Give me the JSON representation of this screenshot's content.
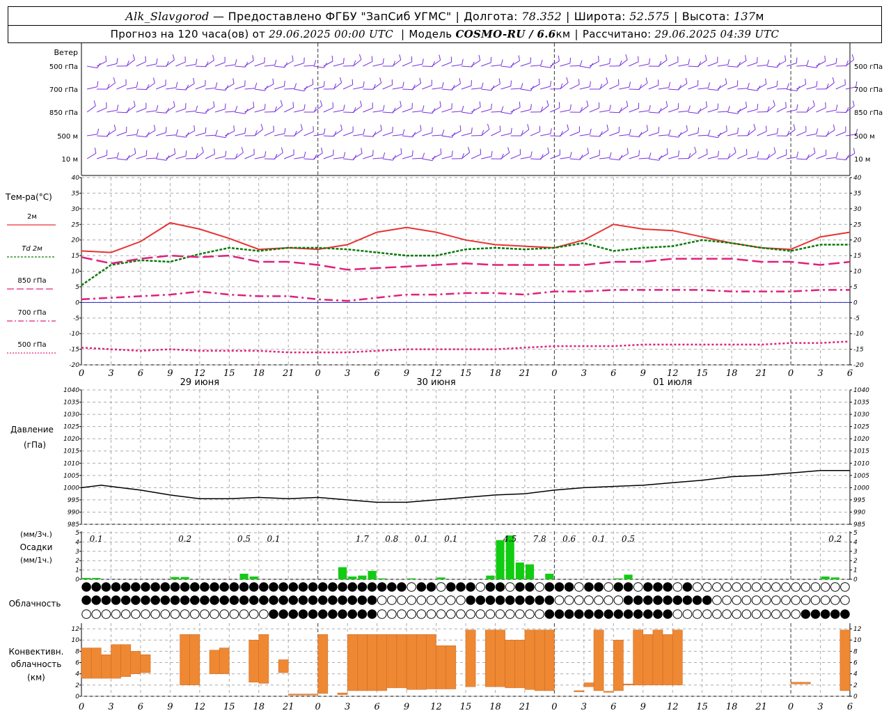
{
  "header": {
    "station": "Alk_Slavgorod",
    "provider": "— Предоставлено ФГБУ \"ЗапСиб УГМС\"",
    "lon_label": "Долгота:",
    "lon_value": "78.352",
    "lat_label": "Широта:",
    "lat_value": "52.575",
    "alt_label": "Высота:",
    "alt_value": "137",
    "alt_unit": "м",
    "forecast_prefix": "Прогноз на 120 часа(ов) от",
    "forecast_from": "29.06.2025 00:00 UTC",
    "model_label": "Модель",
    "model_value": "COSMO-RU / 6.6",
    "model_unit": "км",
    "computed_label": "Рассчитано:",
    "computed_value": "29.06.2025 04:39 UTC"
  },
  "panels": {
    "wind": {
      "title": "Ветер",
      "levels": [
        "500 гПа",
        "700 гПа",
        "850 гПа",
        "500 м",
        "10  м"
      ]
    },
    "temp": {
      "title": "Тем-ра(°C)",
      "legend": [
        {
          "label": "2м",
          "color": "#e83232",
          "style": "solid"
        },
        {
          "label": "Td  2м",
          "color": "#0a7a0a",
          "style": "dashed-short"
        },
        {
          "label": "850 гПа",
          "color": "#e0207c",
          "style": "dashed-long"
        },
        {
          "label": "700 гПа",
          "color": "#e0207c",
          "style": "dashdot"
        },
        {
          "label": "500 гПа",
          "color": "#e0207c",
          "style": "dotted"
        }
      ]
    },
    "pressure": {
      "title1": "Давление",
      "title2": "(гПа)"
    },
    "precip": {
      "title1": "(мм/3ч.)",
      "title2": "Осадки",
      "title3": "(мм/1ч.)"
    },
    "cloud": {
      "title": "Облачность"
    },
    "conv": {
      "title1": "Конвективн.",
      "title2": "облачность",
      "title3": "(км)"
    }
  },
  "dates": [
    "29 июня",
    "30 июня",
    "01 июля"
  ],
  "hour_ticks": [
    "0",
    "3",
    "6",
    "9",
    "12",
    "15",
    "18",
    "21",
    "0",
    "3",
    "6",
    "9",
    "12",
    "15",
    "18",
    "21",
    "0",
    "3",
    "6",
    "9",
    "12",
    "15",
    "18",
    "21",
    "0",
    "3",
    "6"
  ],
  "colors": {
    "temp2m": "#e83232",
    "td2m": "#0a7a0a",
    "upper": "#e0207c",
    "precip": "#11cc11",
    "conv": "#ee8833",
    "wind": "#7a2ee0",
    "pressure": "#000000"
  },
  "chart_data": [
    {
      "type": "line",
      "title": "Тем-ра(°C)",
      "x_hours": [
        0,
        3,
        6,
        9,
        12,
        15,
        18,
        21,
        24,
        27,
        30,
        33,
        36,
        39,
        42,
        45,
        48,
        51,
        54,
        57,
        60,
        63,
        66,
        69,
        72,
        75,
        78
      ],
      "ylim": [
        -20,
        40
      ],
      "yticks": [
        -20,
        -15,
        -10,
        -5,
        0,
        5,
        10,
        15,
        20,
        25,
        30,
        35,
        40
      ],
      "series": [
        {
          "name": "2м",
          "values": [
            16.5,
            16,
            19.5,
            25.5,
            23.5,
            20.5,
            17,
            17.5,
            17,
            18.5,
            22.5,
            24,
            22.5,
            20,
            18.5,
            18,
            17.5,
            20,
            25,
            23.5,
            23,
            21,
            19,
            17.5,
            17,
            21,
            22.5
          ]
        },
        {
          "name": "Td  2м",
          "values": [
            5.5,
            12,
            13.5,
            13,
            15.5,
            17.5,
            16.5,
            17.5,
            17.5,
            17,
            16,
            15,
            15,
            17,
            17.5,
            17,
            17.5,
            19,
            16.5,
            17.5,
            18,
            20,
            19,
            17.5,
            16.5,
            18.5,
            18.5
          ]
        },
        {
          "name": "850 гПа",
          "values": [
            14.5,
            12.5,
            14,
            15,
            14.5,
            15,
            13,
            13,
            12,
            10.5,
            11,
            11.5,
            12,
            12.5,
            12,
            12,
            12,
            12,
            13,
            13,
            14,
            14,
            14,
            13,
            13,
            12,
            13
          ]
        },
        {
          "name": "700 гПа",
          "values": [
            1,
            1.5,
            2,
            2.5,
            3.5,
            2.5,
            2,
            2,
            1,
            0.5,
            1.5,
            2.5,
            2.5,
            3,
            3,
            2.5,
            3.5,
            3.5,
            4,
            4,
            4,
            4,
            3.5,
            3.5,
            3.5,
            4,
            4
          ]
        },
        {
          "name": "500 гПа",
          "values": [
            -14.5,
            -15,
            -15.5,
            -15,
            -15.5,
            -15.5,
            -15.5,
            -16,
            -16,
            -16,
            -15.5,
            -15,
            -15,
            -15,
            -15,
            -14.5,
            -14,
            -14,
            -14,
            -13.5,
            -13.5,
            -13.5,
            -13.5,
            -13.5,
            -13,
            -13,
            -12.5
          ]
        }
      ]
    },
    {
      "type": "line",
      "title": "Давление",
      "ylabel": "(гПа)",
      "x_hours": [
        0,
        2,
        4,
        6,
        9,
        12,
        15,
        18,
        21,
        24,
        27,
        30,
        33,
        36,
        39,
        42,
        45,
        48,
        51,
        54,
        57,
        60,
        63,
        66,
        69,
        72,
        75,
        78
      ],
      "ylim": [
        985,
        1040
      ],
      "yticks": [
        985,
        990,
        995,
        1000,
        1005,
        1010,
        1015,
        1020,
        1025,
        1030,
        1035,
        1040
      ],
      "series": [
        {
          "name": "Давление",
          "values": [
            1000,
            1001,
            1000,
            999,
            997,
            995.5,
            995.5,
            996,
            995.5,
            996,
            995,
            994,
            994,
            995,
            996,
            997,
            997.5,
            999,
            1000,
            1000.5,
            1001,
            1002,
            1003,
            1004.5,
            1005,
            1006,
            1007,
            1007
          ]
        }
      ]
    },
    {
      "type": "bar",
      "title": "Осадки",
      "ylabel": "(мм/1ч.)",
      "ylim": [
        0,
        5
      ],
      "yticks": [
        0,
        1,
        2,
        3,
        4,
        5
      ],
      "x_hours": [
        1,
        2,
        10,
        11,
        17,
        18,
        27,
        28,
        29,
        30,
        31,
        34,
        37,
        42,
        43,
        44,
        45,
        46,
        48,
        55,
        56,
        76,
        77
      ],
      "values": [
        0.15,
        0.15,
        0.25,
        0.25,
        0.6,
        0.3,
        1.3,
        0.3,
        0.4,
        0.9,
        0.1,
        0.1,
        0.2,
        0.4,
        4.2,
        4.7,
        1.8,
        1.6,
        0.6,
        0.1,
        0.5,
        0.3,
        0.2
      ],
      "labels_3h": [
        {
          "x_hour": 1.5,
          "text": "0.1"
        },
        {
          "x_hour": 10.5,
          "text": "0.2"
        },
        {
          "x_hour": 16.5,
          "text": "0.5"
        },
        {
          "x_hour": 19.5,
          "text": "0.1"
        },
        {
          "x_hour": 28.5,
          "text": "1.7"
        },
        {
          "x_hour": 31.5,
          "text": "0.8"
        },
        {
          "x_hour": 34.5,
          "text": "0.1"
        },
        {
          "x_hour": 37.5,
          "text": "0.1"
        },
        {
          "x_hour": 43.5,
          "text": "4.5"
        },
        {
          "x_hour": 46.5,
          "text": "7.8"
        },
        {
          "x_hour": 49.5,
          "text": "0.6"
        },
        {
          "x_hour": 52.5,
          "text": "0.1"
        },
        {
          "x_hour": 55.5,
          "text": "0.5"
        },
        {
          "x_hour": 76.5,
          "text": "0.2"
        }
      ]
    },
    {
      "type": "bar",
      "title": "Конвективн. облачность",
      "ylabel": "(км)",
      "ylim": [
        0,
        13
      ],
      "yticks": [
        0,
        2,
        4,
        6,
        8,
        10,
        12
      ],
      "bars": [
        {
          "x_hour": 0.5,
          "bottom": 3.2,
          "top": 8.6
        },
        {
          "x_hour": 1.5,
          "bottom": 3.2,
          "top": 8.6
        },
        {
          "x_hour": 2.5,
          "bottom": 3.2,
          "top": 7.4
        },
        {
          "x_hour": 3.5,
          "bottom": 3.2,
          "top": 9.2
        },
        {
          "x_hour": 4.5,
          "bottom": 3.5,
          "top": 9.2
        },
        {
          "x_hour": 5.5,
          "bottom": 4.0,
          "top": 8.0
        },
        {
          "x_hour": 6.5,
          "bottom": 4.2,
          "top": 7.4
        },
        {
          "x_hour": 10.5,
          "bottom": 2.0,
          "top": 11.0
        },
        {
          "x_hour": 11.5,
          "bottom": 2.0,
          "top": 11.0
        },
        {
          "x_hour": 13.5,
          "bottom": 4.0,
          "top": 8.2
        },
        {
          "x_hour": 14.5,
          "bottom": 4.0,
          "top": 8.6
        },
        {
          "x_hour": 17.5,
          "bottom": 2.5,
          "top": 10.0
        },
        {
          "x_hour": 18.5,
          "bottom": 2.3,
          "top": 11.0
        },
        {
          "x_hour": 20.5,
          "bottom": 4.2,
          "top": 6.5
        },
        {
          "x_hour": 21.5,
          "bottom": 0.2,
          "top": 0.4
        },
        {
          "x_hour": 22.5,
          "bottom": 0.2,
          "top": 0.4
        },
        {
          "x_hour": 23.5,
          "bottom": 0.2,
          "top": 0.4
        },
        {
          "x_hour": 24.5,
          "bottom": 0.5,
          "top": 11.0
        },
        {
          "x_hour": 26.5,
          "bottom": 0.3,
          "top": 0.6
        },
        {
          "x_hour": 27.5,
          "bottom": 1.0,
          "top": 11.0
        },
        {
          "x_hour": 28.5,
          "bottom": 1.0,
          "top": 11.0
        },
        {
          "x_hour": 29.5,
          "bottom": 1.0,
          "top": 11.0
        },
        {
          "x_hour": 30.5,
          "bottom": 1.0,
          "top": 11.0
        },
        {
          "x_hour": 31.5,
          "bottom": 1.5,
          "top": 11.0
        },
        {
          "x_hour": 32.5,
          "bottom": 1.5,
          "top": 11.0
        },
        {
          "x_hour": 33.5,
          "bottom": 1.2,
          "top": 11.0
        },
        {
          "x_hour": 34.5,
          "bottom": 1.2,
          "top": 11.0
        },
        {
          "x_hour": 35.5,
          "bottom": 1.3,
          "top": 11.0
        },
        {
          "x_hour": 36.5,
          "bottom": 1.3,
          "top": 9.0
        },
        {
          "x_hour": 37.5,
          "bottom": 1.3,
          "top": 9.0
        },
        {
          "x_hour": 39.5,
          "bottom": 1.7,
          "top": 11.8
        },
        {
          "x_hour": 41.5,
          "bottom": 1.7,
          "top": 11.8
        },
        {
          "x_hour": 42.5,
          "bottom": 1.7,
          "top": 11.8
        },
        {
          "x_hour": 43.5,
          "bottom": 1.5,
          "top": 10.0
        },
        {
          "x_hour": 44.5,
          "bottom": 1.5,
          "top": 10.0
        },
        {
          "x_hour": 45.5,
          "bottom": 1.2,
          "top": 11.8
        },
        {
          "x_hour": 46.5,
          "bottom": 1.0,
          "top": 11.8
        },
        {
          "x_hour": 47.5,
          "bottom": 1.0,
          "top": 11.8
        },
        {
          "x_hour": 50.5,
          "bottom": 0.8,
          "top": 1.0
        },
        {
          "x_hour": 51.5,
          "bottom": 1.7,
          "top": 2.4
        },
        {
          "x_hour": 52.5,
          "bottom": 1.0,
          "top": 11.8
        },
        {
          "x_hour": 53.5,
          "bottom": 0.7,
          "top": 0.9
        },
        {
          "x_hour": 54.5,
          "bottom": 1.0,
          "top": 10.0
        },
        {
          "x_hour": 55.5,
          "bottom": 2.0,
          "top": 2.2
        },
        {
          "x_hour": 56.5,
          "bottom": 2.0,
          "top": 11.8
        },
        {
          "x_hour": 57.5,
          "bottom": 2.0,
          "top": 11.0
        },
        {
          "x_hour": 58.5,
          "bottom": 2.0,
          "top": 11.8
        },
        {
          "x_hour": 59.5,
          "bottom": 2.0,
          "top": 11.0
        },
        {
          "x_hour": 60.5,
          "bottom": 2.0,
          "top": 11.8
        },
        {
          "x_hour": 72.5,
          "bottom": 2.2,
          "top": 2.5
        },
        {
          "x_hour": 73.5,
          "bottom": 2.2,
          "top": 2.5
        },
        {
          "x_hour": 77.5,
          "bottom": 1.0,
          "top": 11.8
        }
      ]
    }
  ]
}
